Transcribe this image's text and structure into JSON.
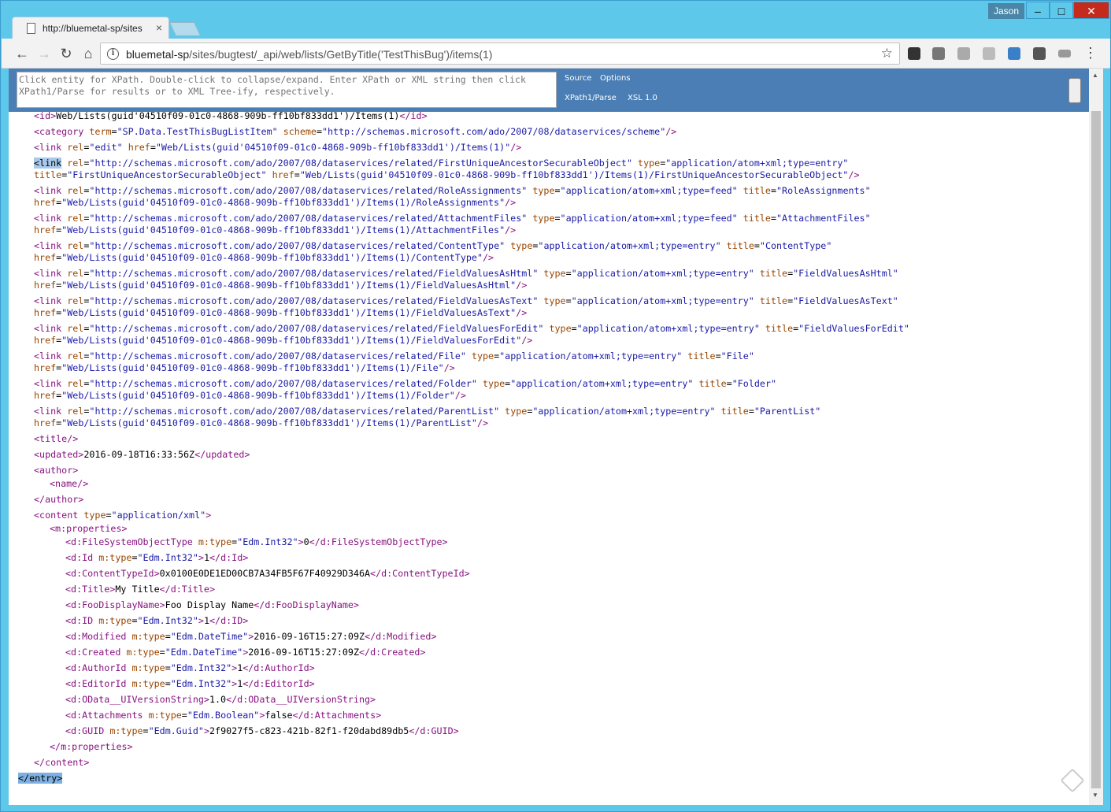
{
  "window": {
    "user": "Jason",
    "controls": {
      "minimize": "–",
      "maximize": "□",
      "close": "✕"
    }
  },
  "tab": {
    "title": "http://bluemetal-sp/sites",
    "close": "×"
  },
  "toolbar": {
    "back": "←",
    "forward": "→",
    "reload": "↻",
    "home": "⌂",
    "url_host": "bluemetal-sp",
    "url_path": "/sites/bugtest/_api/web/lists/GetByTitle('TestThisBug')/items(1)",
    "star": "☆",
    "menu": "⋮",
    "extensions": [
      {
        "icon": "owl-extension-icon",
        "color": "#333333"
      },
      {
        "icon": "puzzle-extension-icon",
        "color": "#777777"
      },
      {
        "icon": "keyboard-extension-icon",
        "color": "#aaaaaa"
      },
      {
        "icon": "rss-extension-icon",
        "color": "#bbbbbb"
      },
      {
        "icon": "xpath-extension-icon",
        "color": "#3a7fc7"
      },
      {
        "icon": "pen-extension-icon",
        "color": "#555555"
      },
      {
        "icon": "battery-extension-icon",
        "color": "#999999"
      }
    ]
  },
  "xpath": {
    "placeholder": "Click entity for XPath. Double-click to collapse/expand. Enter XPath or XML string then click XPath1/Parse for results or to XML Tree-ify, respectively.",
    "source": "Source",
    "options": "Options",
    "parse": "XPath1/Parse",
    "xsl": "XSL 1.0"
  },
  "xml": {
    "id_line": [
      "<id>",
      "Web/Lists(guid'04510f09-01c0-4868-909b-ff10bf833dd1')/Items(1)",
      "</id>"
    ],
    "category": {
      "term": "SP.Data.TestThisBugListItem",
      "scheme": "http://schemas.microsoft.com/ado/2007/08/dataservices/scheme"
    },
    "edit_href": "Web/Lists(guid'04510f09-01c0-4868-909b-ff10bf833dd1')/Items(1)",
    "links": [
      {
        "rel": "http://schemas.microsoft.com/ado/2007/08/dataservices/related/FirstUniqueAncestorSecurableObject",
        "type": "application/atom+xml;type=entry",
        "title": "FirstUniqueAncestorSecurableObject",
        "href": "Web/Lists(guid'04510f09-01c0-4868-909b-ff10bf833dd1')/Items(1)/FirstUniqueAncestorSecurableObject"
      },
      {
        "rel": "http://schemas.microsoft.com/ado/2007/08/dataservices/related/RoleAssignments",
        "type": "application/atom+xml;type=feed",
        "title": "RoleAssignments",
        "href": "Web/Lists(guid'04510f09-01c0-4868-909b-ff10bf833dd1')/Items(1)/RoleAssignments"
      },
      {
        "rel": "http://schemas.microsoft.com/ado/2007/08/dataservices/related/AttachmentFiles",
        "type": "application/atom+xml;type=feed",
        "title": "AttachmentFiles",
        "href": "Web/Lists(guid'04510f09-01c0-4868-909b-ff10bf833dd1')/Items(1)/AttachmentFiles"
      },
      {
        "rel": "http://schemas.microsoft.com/ado/2007/08/dataservices/related/ContentType",
        "type": "application/atom+xml;type=entry",
        "title": "ContentType",
        "href": "Web/Lists(guid'04510f09-01c0-4868-909b-ff10bf833dd1')/Items(1)/ContentType"
      },
      {
        "rel": "http://schemas.microsoft.com/ado/2007/08/dataservices/related/FieldValuesAsHtml",
        "type": "application/atom+xml;type=entry",
        "title": "FieldValuesAsHtml",
        "href": "Web/Lists(guid'04510f09-01c0-4868-909b-ff10bf833dd1')/Items(1)/FieldValuesAsHtml"
      },
      {
        "rel": "http://schemas.microsoft.com/ado/2007/08/dataservices/related/FieldValuesAsText",
        "type": "application/atom+xml;type=entry",
        "title": "FieldValuesAsText",
        "href": "Web/Lists(guid'04510f09-01c0-4868-909b-ff10bf833dd1')/Items(1)/FieldValuesAsText"
      },
      {
        "rel": "http://schemas.microsoft.com/ado/2007/08/dataservices/related/FieldValuesForEdit",
        "type": "application/atom+xml;type=entry",
        "title": "FieldValuesForEdit",
        "href": "Web/Lists(guid'04510f09-01c0-4868-909b-ff10bf833dd1')/Items(1)/FieldValuesForEdit"
      },
      {
        "rel": "http://schemas.microsoft.com/ado/2007/08/dataservices/related/File",
        "type": "application/atom+xml;type=entry",
        "title": "File",
        "href": "Web/Lists(guid'04510f09-01c0-4868-909b-ff10bf833dd1')/Items(1)/File"
      },
      {
        "rel": "http://schemas.microsoft.com/ado/2007/08/dataservices/related/Folder",
        "type": "application/atom+xml;type=entry",
        "title": "Folder",
        "href": "Web/Lists(guid'04510f09-01c0-4868-909b-ff10bf833dd1')/Items(1)/Folder"
      },
      {
        "rel": "http://schemas.microsoft.com/ado/2007/08/dataservices/related/ParentList",
        "type": "application/atom+xml;type=entry",
        "title": "ParentList",
        "href": "Web/Lists(guid'04510f09-01c0-4868-909b-ff10bf833dd1')/Items(1)/ParentList"
      }
    ],
    "updated": "2016-09-18T16:33:56Z",
    "content_type": "application/xml",
    "properties": [
      {
        "name": "d:FileSystemObjectType",
        "mtype": "Edm.Int32",
        "value": "0"
      },
      {
        "name": "d:Id",
        "mtype": "Edm.Int32",
        "value": "1"
      },
      {
        "name": "d:ContentTypeId",
        "mtype": "",
        "value": "0x0100E0DE1ED00CB7A34FB5F67F40929D346A"
      },
      {
        "name": "d:Title",
        "mtype": "",
        "value": "My Title"
      },
      {
        "name": "d:FooDisplayName",
        "mtype": "",
        "value": "Foo Display Name"
      },
      {
        "name": "d:ID",
        "mtype": "Edm.Int32",
        "value": "1"
      },
      {
        "name": "d:Modified",
        "mtype": "Edm.DateTime",
        "value": "2016-09-16T15:27:09Z"
      },
      {
        "name": "d:Created",
        "mtype": "Edm.DateTime",
        "value": "2016-09-16T15:27:09Z"
      },
      {
        "name": "d:AuthorId",
        "mtype": "Edm.Int32",
        "value": "1"
      },
      {
        "name": "d:EditorId",
        "mtype": "Edm.Int32",
        "value": "1"
      },
      {
        "name": "d:OData__UIVersionString",
        "mtype": "",
        "value": "1.0"
      },
      {
        "name": "d:Attachments",
        "mtype": "Edm.Boolean",
        "value": "false"
      },
      {
        "name": "d:GUID",
        "mtype": "Edm.Guid",
        "value": "2f9027f5-c823-421b-82f1-f20dabd89db5"
      }
    ]
  }
}
